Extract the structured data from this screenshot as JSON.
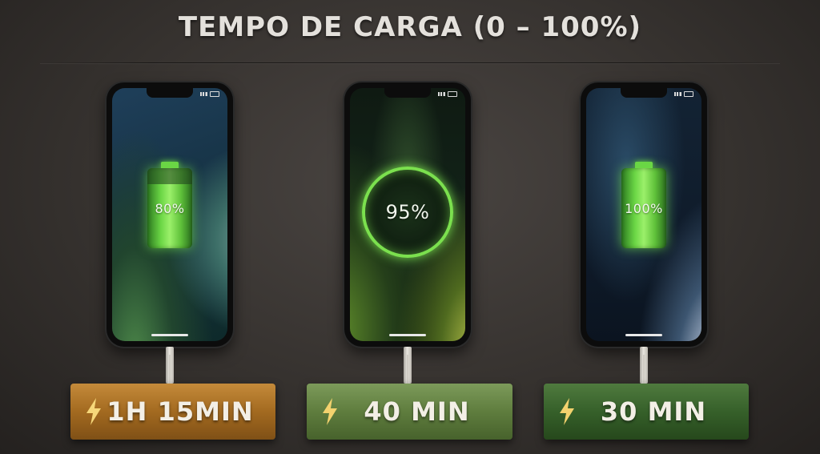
{
  "title": "TEMPO DE CARGA (0 – 100%)",
  "phones": [
    {
      "display": "80%",
      "indicator": "battery-icon",
      "level": 0.8
    },
    {
      "display": "95%",
      "indicator": "ring",
      "level": 0.95
    },
    {
      "display": "100%",
      "indicator": "battery-icon",
      "level": 1.0
    }
  ],
  "badges": [
    {
      "time": "1H 15MIN",
      "color": "#a36a20",
      "icon": "lightning-icon"
    },
    {
      "time": "40 MIN",
      "color": "#5f7d3e",
      "icon": "lightning-icon"
    },
    {
      "time": "30 MIN",
      "color": "#36602a",
      "icon": "lightning-icon"
    }
  ],
  "accent_green": "#6bd645"
}
